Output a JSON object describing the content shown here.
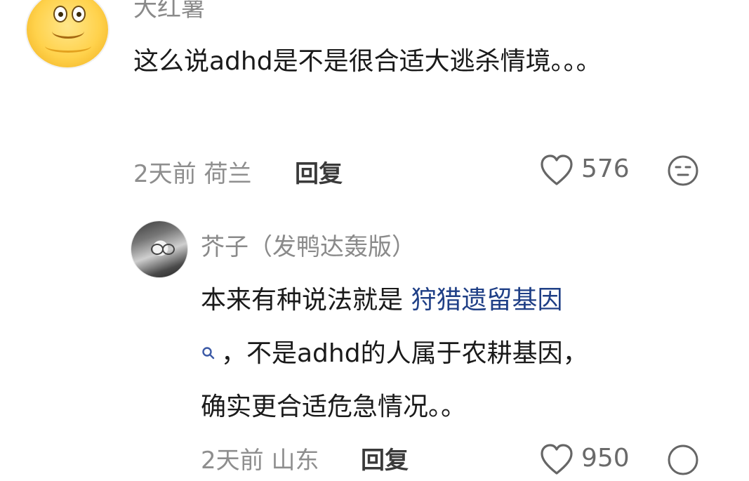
{
  "comment1": {
    "username": "大红薯",
    "text": "这么说adhd是不是很合适大逃杀情境。。。",
    "time": "2天前",
    "location": "荷兰",
    "reply_label": "回复",
    "likes": "576"
  },
  "reply1": {
    "username": "芥子（发鸭达轰版）",
    "text_line1_prefix": "本来有种说法就是 ",
    "link_text": "狩猎遗留基因",
    "text_line2": "，不是adhd的人属于农耕基因，",
    "text_line3": "确实更合适危急情况。。",
    "time": "2天前",
    "location": "山东",
    "reply_label": "回复",
    "likes": "950"
  },
  "icons": {
    "heart": "heart-icon",
    "dislike": "neutral-face-icon",
    "search": "search-icon"
  }
}
